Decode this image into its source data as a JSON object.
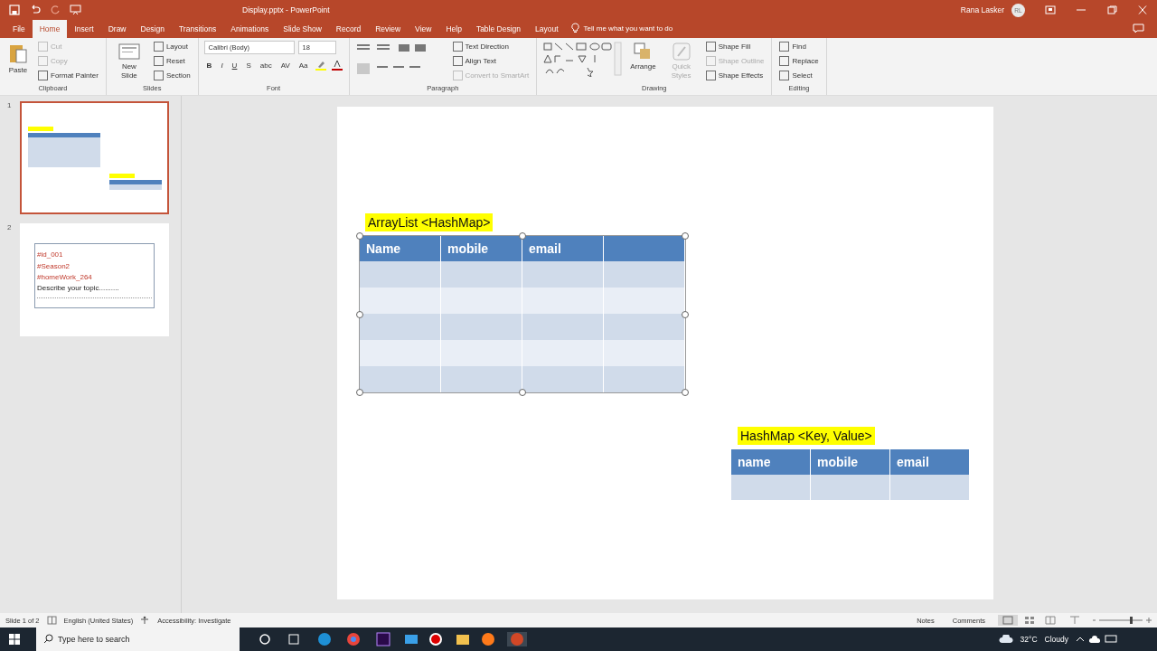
{
  "window": {
    "title": "Display.pptx  -  PowerPoint",
    "user": "Rana Lasker",
    "avatar": "RL"
  },
  "tabs": [
    {
      "label": "File",
      "selected": false
    },
    {
      "label": "Home",
      "selected": true
    },
    {
      "label": "Insert",
      "selected": false
    },
    {
      "label": "Draw",
      "selected": false
    },
    {
      "label": "Design",
      "selected": false
    },
    {
      "label": "Transitions",
      "selected": false
    },
    {
      "label": "Animations",
      "selected": false
    },
    {
      "label": "Slide Show",
      "selected": false
    },
    {
      "label": "Record",
      "selected": false
    },
    {
      "label": "Review",
      "selected": false
    },
    {
      "label": "View",
      "selected": false
    },
    {
      "label": "Help",
      "selected": false
    },
    {
      "label": "Table Design",
      "selected": false
    },
    {
      "label": "Layout",
      "selected": false
    }
  ],
  "tell_me": "Tell me what you want to do",
  "ribbon": {
    "clipboard": {
      "name": "Clipboard",
      "large": "Paste",
      "items": [
        {
          "label": "Cut",
          "disabled": true
        },
        {
          "label": "Copy",
          "disabled": true
        },
        {
          "label": "Format Painter",
          "disabled": false
        }
      ]
    },
    "slides": {
      "name": "Slides",
      "large": "New Slide",
      "items": [
        {
          "label": "Layout",
          "disabled": false
        },
        {
          "label": "Reset",
          "disabled": false
        },
        {
          "label": "Section",
          "disabled": false
        }
      ]
    },
    "font": {
      "name": "Font",
      "font": "Calibri (Body)",
      "size": "18",
      "buttons": [
        "B",
        "I",
        "U",
        "S",
        "abc",
        "AV",
        "Aa"
      ]
    },
    "paragraph": {
      "name": "Paragraph",
      "items": [
        {
          "label": "Text Direction",
          "disabled": false
        },
        {
          "label": "Align Text",
          "disabled": false
        },
        {
          "label": "Convert to SmartArt",
          "disabled": true
        }
      ]
    },
    "drawing": {
      "name": "Drawing",
      "arrange": "Arrange",
      "quick_styles": "Quick Styles",
      "items": [
        {
          "label": "Shape Fill",
          "disabled": false
        },
        {
          "label": "Shape Outline",
          "disabled": true
        },
        {
          "label": "Shape Effects",
          "disabled": false
        }
      ]
    },
    "editing": {
      "name": "Editing",
      "items": [
        {
          "label": "Find",
          "disabled": false
        },
        {
          "label": "Replace",
          "disabled": false
        },
        {
          "label": "Select",
          "disabled": false
        }
      ]
    }
  },
  "thumbnails": [
    {
      "number": "1",
      "selected": true,
      "kind": "tables"
    },
    {
      "number": "2",
      "selected": false,
      "kind": "notes",
      "lines": [
        "#id_001",
        "#Season2",
        "#homeWork_264"
      ],
      "caption": "Describe your topic.........."
    }
  ],
  "slide": {
    "tables": [
      {
        "title": "ArrayList <HashMap>",
        "columns": [
          "Name",
          "mobile",
          "email"
        ],
        "blank_column": true,
        "selected": true
      },
      {
        "title": "HashMap <Key, Value>",
        "columns": [
          "name",
          "mobile",
          "email"
        ],
        "blank_column": false,
        "selected": false
      }
    ]
  },
  "status_bar": {
    "slide": "Slide 1 of 2",
    "language": "English (United States)",
    "accessibility": "Accessibility: Investigate",
    "notes": "Notes",
    "comments": "Comments"
  },
  "taskbar": {
    "search_placeholder": "Type here to search",
    "temperature": "32°C",
    "weather": "Cloudy"
  }
}
